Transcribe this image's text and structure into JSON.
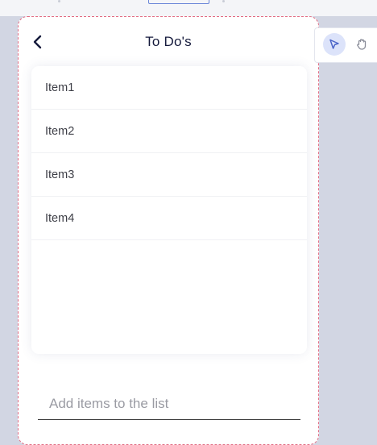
{
  "header": {
    "title": "To Do's",
    "back_icon": "chevron-left-icon"
  },
  "list": {
    "items": [
      {
        "label": "Item1"
      },
      {
        "label": "Item2"
      },
      {
        "label": "Item3"
      },
      {
        "label": "Item4"
      }
    ]
  },
  "add_item": {
    "placeholder": "Add items to the list",
    "value": ""
  },
  "tools": {
    "select_icon": "pointer-icon",
    "hand_icon": "hand-icon",
    "active": "select"
  },
  "colors": {
    "canvas_bg": "#d2d6e3",
    "title_text": "#151a3c",
    "accent": "#6a86d8",
    "selection_outline": "#e26f86"
  }
}
